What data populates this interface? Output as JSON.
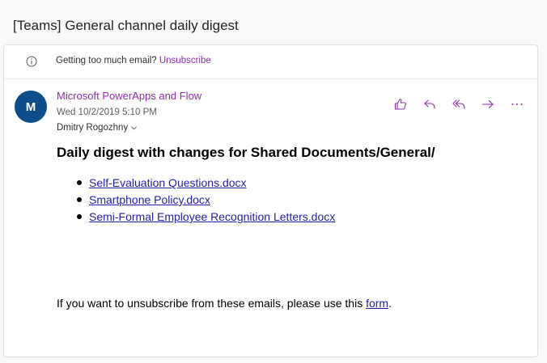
{
  "email": {
    "subject": "[Teams] General channel daily digest",
    "notice": {
      "text": "Getting too much email?",
      "link": "Unsubscribe"
    },
    "sender": {
      "initial": "M",
      "name": "Microsoft PowerApps and Flow",
      "date": "Wed 10/2/2019 5:10 PM",
      "recipient": "Dmitry Rogozhny"
    },
    "actions": [
      "like-icon",
      "reply-icon",
      "reply-all-icon",
      "forward-icon",
      "more-icon"
    ],
    "body": {
      "heading": "Daily digest with changes for Shared Documents/General/",
      "files": [
        "Self-Evaluation Questions.docx",
        "Smartphone Policy.docx",
        "Semi-Formal Employee Recognition Letters.docx"
      ],
      "footer_text": "If you want to unsubscribe from these emails, please use this",
      "footer_link": "form",
      "footer_end": "."
    }
  },
  "colors": {
    "accent": "#8a2fa8",
    "avatar": "#0f4c8a",
    "link": "#1f1fa8"
  }
}
